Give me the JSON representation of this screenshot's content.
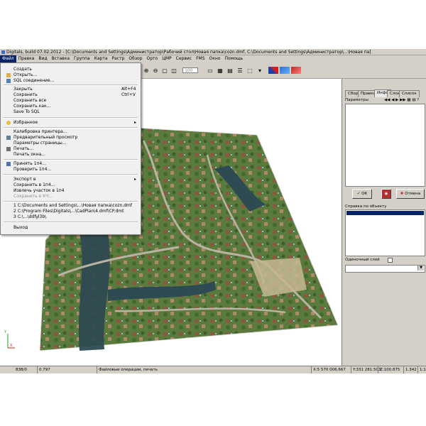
{
  "window": {
    "title": "Digitals, build 07.02.2012 - [C:\\Documents and Settings\\Администратор\\Рабочий стол\\Новая папка\\cozn.dmf, C:\\Documents and Settings\\Администратор\\...\\Новая па]"
  },
  "menubar": [
    "Файл",
    "Правка",
    "Вид",
    "Вставка",
    "Группа",
    "Карта",
    "Растр",
    "Обзор",
    "Орто",
    "ЦМР",
    "Сервис",
    "FMS",
    "Окно",
    "Помощь"
  ],
  "toolbar": {
    "zoom_value": "100"
  },
  "file_menu": {
    "items": [
      {
        "label": "Создать",
        "shortcut": "",
        "disabled": false
      },
      {
        "label": "Открыть...",
        "shortcut": "",
        "disabled": false
      },
      {
        "label": "SQL соединение...",
        "shortcut": "",
        "disabled": false
      },
      {
        "label": "Закрыть",
        "shortcut": "Alt+F4",
        "disabled": false
      },
      {
        "label": "Сохранить",
        "shortcut": "Ctrl+V",
        "disabled": false
      },
      {
        "label": "Сохранить все",
        "shortcut": "",
        "disabled": false
      },
      {
        "label": "Сохранить как...",
        "shortcut": "",
        "disabled": false
      },
      {
        "label": "Save To SQL",
        "shortcut": "",
        "disabled": false
      },
      {
        "label": "Избранное",
        "shortcut": "",
        "disabled": false
      },
      {
        "label": "Калибровка принтера...",
        "shortcut": "",
        "disabled": false
      },
      {
        "label": "Предварительный просмотр",
        "shortcut": "",
        "disabled": false
      },
      {
        "label": "Параметры страницы...",
        "shortcut": "",
        "disabled": false
      },
      {
        "label": "Печать...",
        "shortcut": "",
        "disabled": false
      },
      {
        "label": "Печать окна...",
        "shortcut": "",
        "disabled": false
      },
      {
        "label": "Принять 1п4...",
        "shortcut": "",
        "disabled": false
      },
      {
        "label": "Проверить 1п4...",
        "shortcut": "",
        "disabled": false
      },
      {
        "label": "Экспорт в",
        "shortcut": "",
        "disabled": false
      },
      {
        "label": "Сохранить в 1п4...",
        "shortcut": "",
        "disabled": false
      },
      {
        "label": "Извлечь участок в 1п4",
        "shortcut": "",
        "disabled": false
      },
      {
        "label": "Сохранить в КЧ...",
        "shortcut": "",
        "disabled": true
      },
      {
        "label": "1 C:\\Documents and Settings\\...\\Новая папка\\cozn.dmf",
        "shortcut": "",
        "disabled": false
      },
      {
        "label": "2 C:\\Program Files\\Digitals\\...\\CadPlan\\4.dmf\\CP.dmt",
        "shortcut": "",
        "disabled": false
      },
      {
        "label": "3 C:\\...\\ddfyl3b\\",
        "shortcut": "",
        "disabled": false
      },
      {
        "label": "Выход",
        "shortcut": "",
        "disabled": false
      }
    ]
  },
  "right_panel": {
    "tabs": [
      "Сбор",
      "Правка",
      "Инфо",
      "Слои",
      "Список"
    ],
    "active_tab": "Инфо",
    "params_label": "Параметры",
    "ok_label": "ОК",
    "cancel_label": "Отмена",
    "reference_label": "Справка по объекту",
    "layer_label": "Одиночный слой"
  },
  "status_bar": {
    "scale": "838/0",
    "value2": "0.797",
    "message": "Файловые операции, печать",
    "x": "X:5 570 006.667",
    "y": "Y:331 281.503",
    "z": "Z:100.875",
    "zoom": "1.342",
    "page": "1:1"
  },
  "axis_labels": {
    "x": "X",
    "y": "Y"
  }
}
